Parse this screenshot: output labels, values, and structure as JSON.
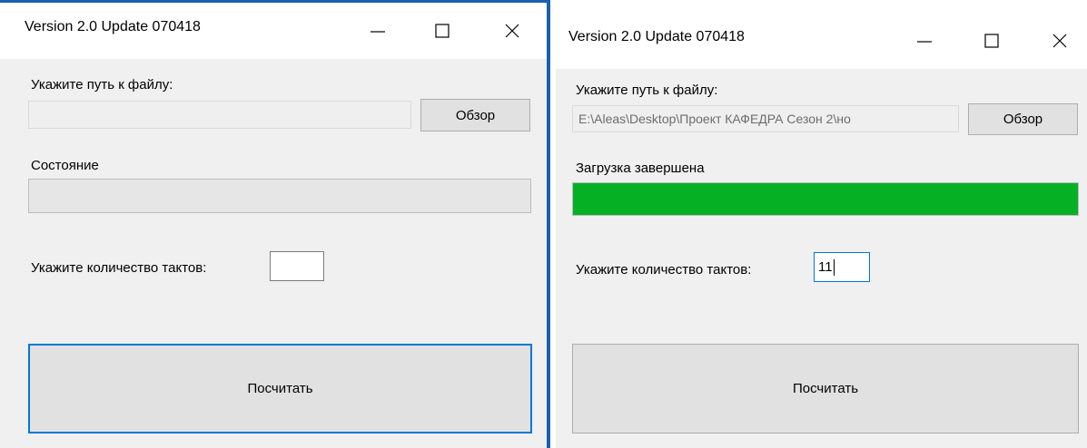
{
  "windows": [
    {
      "title": "Version 2.0 Update 070418",
      "file_label": "Укажите путь к файлу:",
      "file_path": "",
      "browse_label": "Обзор",
      "status_label": "Состояние",
      "progress": 0,
      "ticks_label": "Укажите количество тактов:",
      "ticks_value": "",
      "compute_label": "Посчитать"
    },
    {
      "title": "Version 2.0 Update 070418",
      "file_label": "Укажите путь к файлу:",
      "file_path": "E:\\Aleas\\Desktop\\Проект КАФЕДРА Сезон 2\\но",
      "browse_label": "Обзор",
      "status_label": "Загрузка завершена",
      "progress": 100,
      "ticks_label": "Укажите количество тактов:",
      "ticks_value": "11",
      "compute_label": "Посчитать"
    }
  ],
  "icons": {
    "minimize": "minimize-icon",
    "maximize": "maximize-icon",
    "close": "close-icon"
  },
  "colors": {
    "progress_fill": "#06b025",
    "focus_border": "#0078d7"
  }
}
